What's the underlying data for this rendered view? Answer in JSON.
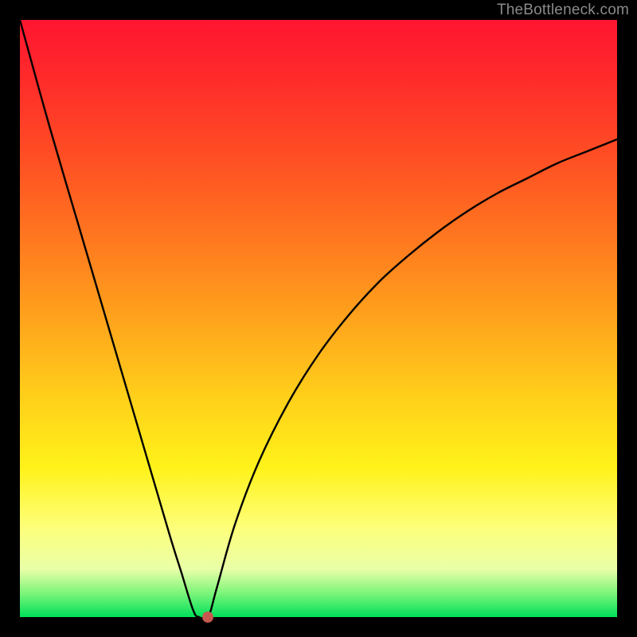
{
  "watermark": "TheBottleneck.com",
  "colors": {
    "frame": "#000000",
    "gradient_top": "#ff1530",
    "gradient_bottom": "#00e05a",
    "curve": "#000000",
    "marker": "#c5594f",
    "watermark_text": "#8a8a8a"
  },
  "chart_data": {
    "type": "line",
    "title": "",
    "xlabel": "",
    "ylabel": "",
    "xlim": [
      0,
      100
    ],
    "ylim": [
      0,
      100
    ],
    "grid": false,
    "legend": false,
    "series": [
      {
        "name": "bottleneck-curve",
        "x": [
          0,
          5,
          10,
          15,
          20,
          25,
          27,
          29,
          30,
          31.5,
          33,
          36,
          40,
          45,
          50,
          55,
          60,
          65,
          70,
          75,
          80,
          85,
          90,
          95,
          100
        ],
        "values": [
          100,
          82,
          65,
          48,
          31,
          14,
          7.6,
          1.2,
          0,
          0,
          5,
          15.5,
          26,
          36,
          44,
          50.5,
          56,
          60.5,
          64.5,
          68,
          71,
          73.5,
          76,
          78,
          80
        ]
      }
    ],
    "annotations": [
      {
        "name": "optimal-marker",
        "x": 31.5,
        "y": 0,
        "shape": "circle",
        "color": "#c5594f"
      }
    ],
    "notes": "y=0 is bottom (green / good), y=100 is top (red / bad). The curve is a V-shape reaching y≈0 near x≈30–31, with the right branch asymptoting toward y≈80 at x=100."
  }
}
